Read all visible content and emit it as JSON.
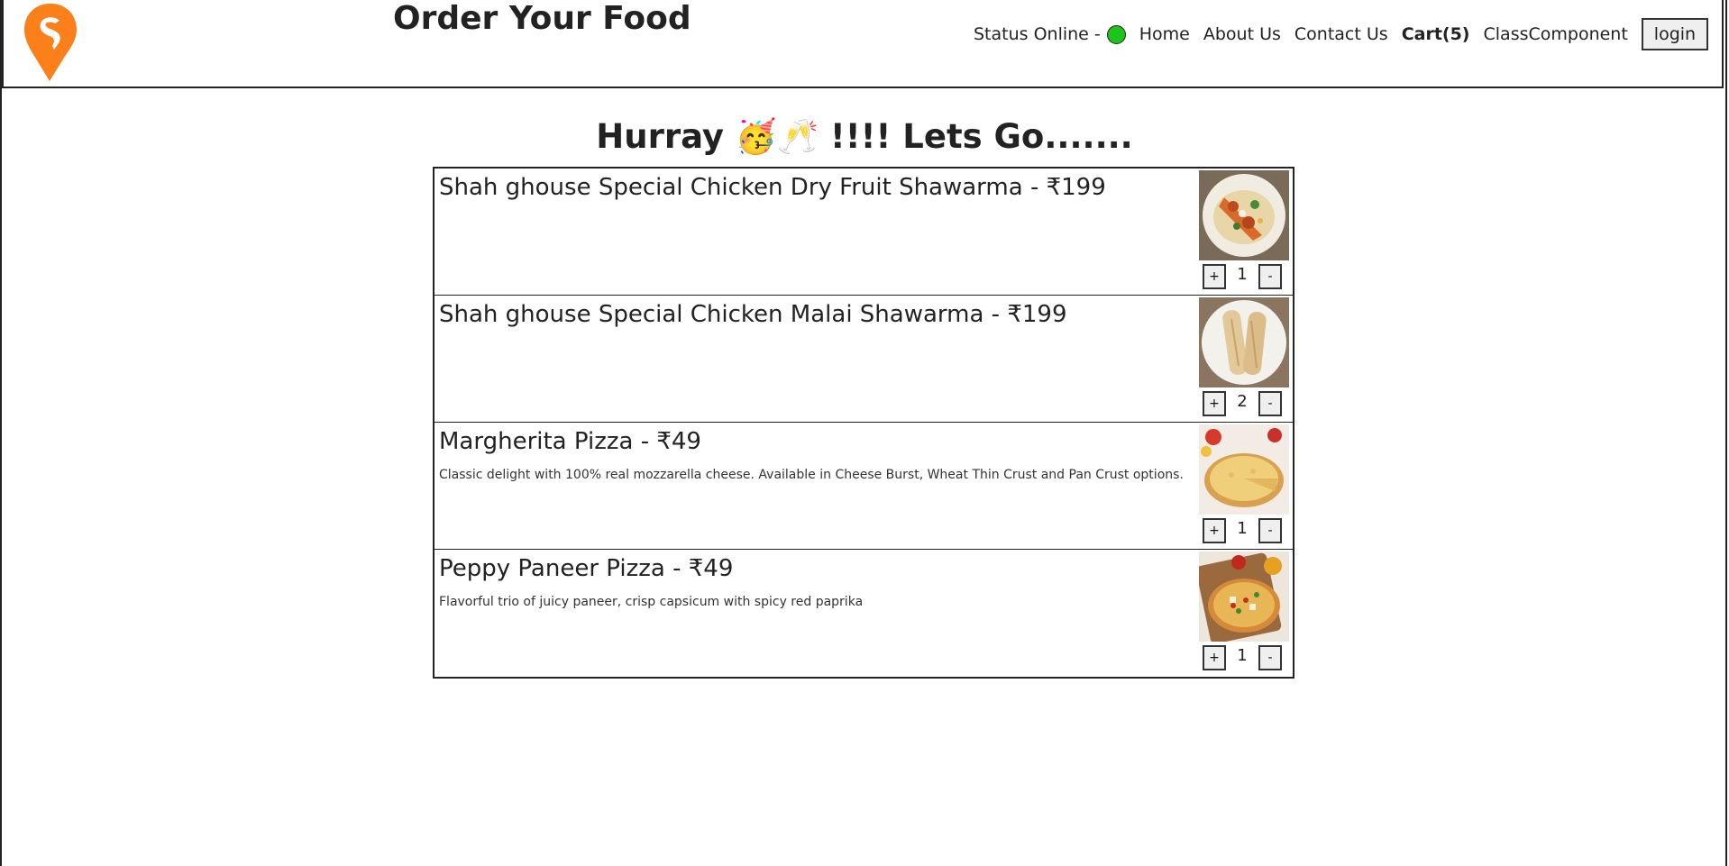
{
  "header": {
    "logo_icon": "swiggy-pin-logo",
    "title": "Order Your Food",
    "status_label": "Status Online -",
    "status_color": "#1fc41b",
    "nav": {
      "home": "Home",
      "about": "About Us",
      "contact": "Contact Us",
      "cart": "Cart(5)",
      "class_component": "ClassComponent"
    },
    "login_label": "login"
  },
  "heading": "Hurray 🥳🥂 !!!! Lets Go.......",
  "items": [
    {
      "title": "Shah ghouse Special Chicken Dry Fruit Shawarma - ₹199",
      "description": "",
      "image": "chicken-dry-fruit-shawarma-image",
      "plus": "+",
      "qty": "1",
      "minus": "-"
    },
    {
      "title": "Shah ghouse Special Chicken Malai Shawarma - ₹199",
      "description": "",
      "image": "chicken-malai-shawarma-image",
      "plus": "+",
      "qty": "2",
      "minus": "-"
    },
    {
      "title": "Margherita Pizza - ₹49",
      "description": "Classic delight with 100% real mozzarella cheese. Available in Cheese Burst, Wheat Thin Crust and Pan Crust options.",
      "image": "margherita-pizza-image",
      "plus": "+",
      "qty": "1",
      "minus": "-"
    },
    {
      "title": "Peppy Paneer Pizza - ₹49",
      "description": "Flavorful trio of juicy paneer, crisp capsicum with spicy red paprika",
      "image": "peppy-paneer-pizza-image",
      "plus": "+",
      "qty": "1",
      "minus": "-"
    }
  ],
  "colors": {
    "brand_orange": "#fc8019",
    "border": "#222222"
  }
}
